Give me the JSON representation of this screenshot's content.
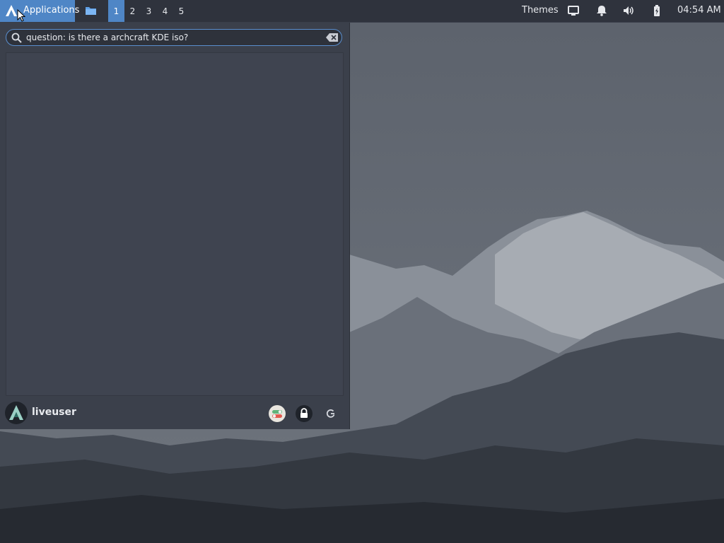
{
  "panel": {
    "apps_label": "Applications",
    "workspaces": [
      "1",
      "2",
      "3",
      "4",
      "5"
    ],
    "active_workspace": 0,
    "themes_label": "Themes",
    "clock": "04:54 AM",
    "tray_icons": [
      "display-icon",
      "bell-icon",
      "volume-icon",
      "battery-icon"
    ]
  },
  "menu": {
    "search_value": "question: is there a archcraft KDE iso?",
    "user_name": "liveuser",
    "footer_icons": [
      "settings-toggle-icon",
      "lock-icon",
      "logout-icon"
    ]
  },
  "colors": {
    "accent": "#4f86c6",
    "panel": "#2f333d",
    "menu_bg": "#3b404b"
  }
}
